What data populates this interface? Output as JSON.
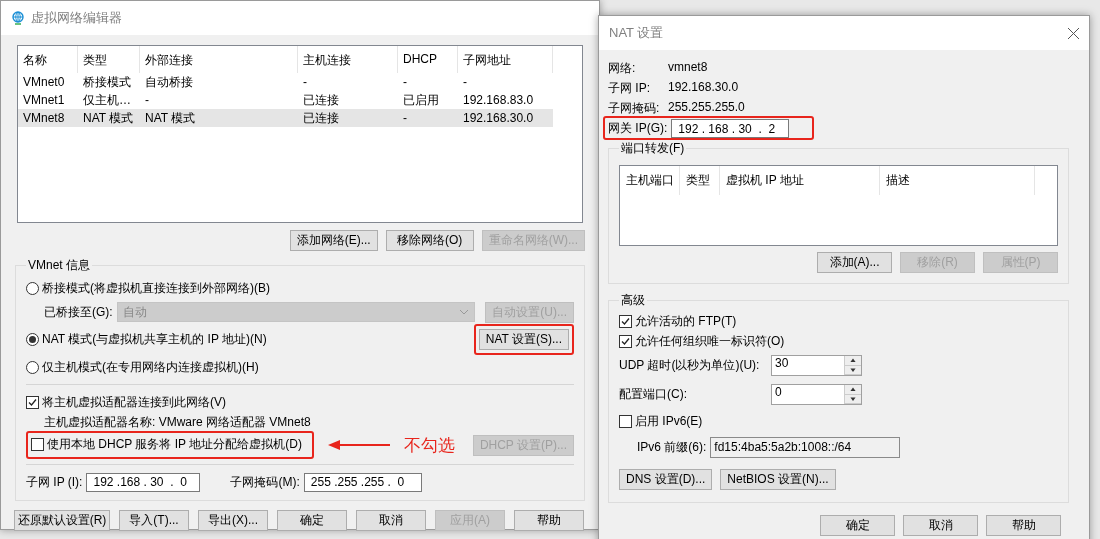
{
  "editor": {
    "title": "虚拟网络编辑器",
    "columns": [
      "名称",
      "类型",
      "外部连接",
      "主机连接",
      "DHCP",
      "子网地址"
    ],
    "rows": [
      {
        "cells": [
          "VMnet0",
          "桥接模式",
          "自动桥接",
          "-",
          "-",
          "-"
        ],
        "selected": false
      },
      {
        "cells": [
          "VMnet1",
          "仅主机…",
          "-",
          "已连接",
          "已启用",
          "192.168.83.0"
        ],
        "selected": false
      },
      {
        "cells": [
          "VMnet8",
          "NAT 模式",
          "NAT 模式",
          "已连接",
          "-",
          "192.168.30.0"
        ],
        "selected": true
      }
    ],
    "list_buttons": [
      {
        "label": "添加网络(E)...",
        "disabled": false
      },
      {
        "label": "移除网络(O)",
        "disabled": false
      },
      {
        "label": "重命名网络(W)...",
        "disabled": true
      }
    ],
    "info": {
      "title": "VMnet 信息",
      "bridged": {
        "label": "桥接模式(将虚拟机直接连接到外部网络)(B)",
        "selected": false
      },
      "bridged_to": {
        "label": "已桥接至(G):",
        "value": "自动",
        "disabled": true
      },
      "auto_button": {
        "label": "自动设置(U)...",
        "disabled": true
      },
      "nat": {
        "label": "NAT 模式(与虚拟机共享主机的 IP 地址)(N)",
        "selected": true
      },
      "nat_button": {
        "label": "NAT 设置(S)...",
        "disabled": false,
        "highlighted": true
      },
      "host_only": {
        "label": "仅主机模式(在专用网络内连接虚拟机)(H)",
        "selected": false
      },
      "connect_adapter": {
        "label": "将主机虚拟适配器连接到此网络(V)",
        "checked": true
      },
      "adapter_name": "主机虚拟适配器名称: VMware 网络适配器 VMnet8",
      "dhcp": {
        "label": "使用本地 DHCP 服务将 IP 地址分配给虚拟机(D)",
        "checked": false,
        "highlighted": true
      },
      "annotation": "不勾选",
      "dhcp_button": {
        "label": "DHCP 设置(P)...",
        "disabled": true
      },
      "subnet_ip": {
        "label": "子网 IP (I):",
        "value": "192 .168 . 30  .  0"
      },
      "subnet_mask": {
        "label": "子网掩码(M):",
        "value": "255 .255 .255 .  0"
      }
    },
    "footer_buttons": [
      {
        "label": "还原默认设置(R)",
        "disabled": false
      },
      {
        "label": "导入(T)...",
        "disabled": false
      },
      {
        "label": "导出(X)...",
        "disabled": false
      },
      {
        "label": "确定",
        "disabled": false
      },
      {
        "label": "取消",
        "disabled": false
      },
      {
        "label": "应用(A)",
        "disabled": true
      },
      {
        "label": "帮助",
        "disabled": false
      }
    ]
  },
  "nat_settings": {
    "title": "NAT 设置",
    "info": [
      {
        "label": "网络:",
        "value": "vmnet8"
      },
      {
        "label": "子网 IP:",
        "value": "192.168.30.0"
      },
      {
        "label": "子网掩码:",
        "value": "255.255.255.0"
      }
    ],
    "gateway": {
      "label": "网关 IP(G):",
      "value": "192 . 168 . 30  .  2",
      "highlighted": true
    },
    "port_forwarding": {
      "title": "端口转发(F)",
      "columns": [
        "主机端口",
        "类型",
        "虚拟机 IP 地址",
        "描述"
      ],
      "buttons": [
        {
          "label": "添加(A)...",
          "disabled": false
        },
        {
          "label": "移除(R)",
          "disabled": true
        },
        {
          "label": "属性(P)",
          "disabled": true
        }
      ]
    },
    "advanced": {
      "title": "高级",
      "checks": [
        {
          "label": "允许活动的 FTP(T)",
          "checked": true
        },
        {
          "label": "允许任何组织唯一标识符(O)",
          "checked": true
        }
      ],
      "spinners": [
        {
          "label": "UDP 超时(以秒为单位)(U):",
          "value": "30"
        },
        {
          "label": "配置端口(C):",
          "value": "0"
        }
      ],
      "ipv6": {
        "label": "启用 IPv6(E)",
        "checked": false
      },
      "prefix": {
        "label": "IPv6 前缀(6):",
        "value": "fd15:4ba5:5a2b:1008::/64",
        "disabled": true
      },
      "buttons": [
        {
          "label": "DNS 设置(D)...",
          "disabled": false
        },
        {
          "label": "NetBIOS 设置(N)...",
          "disabled": false
        }
      ]
    },
    "footer_buttons": [
      {
        "label": "确定",
        "disabled": false
      },
      {
        "label": "取消",
        "disabled": false
      },
      {
        "label": "帮助",
        "disabled": false
      }
    ]
  }
}
